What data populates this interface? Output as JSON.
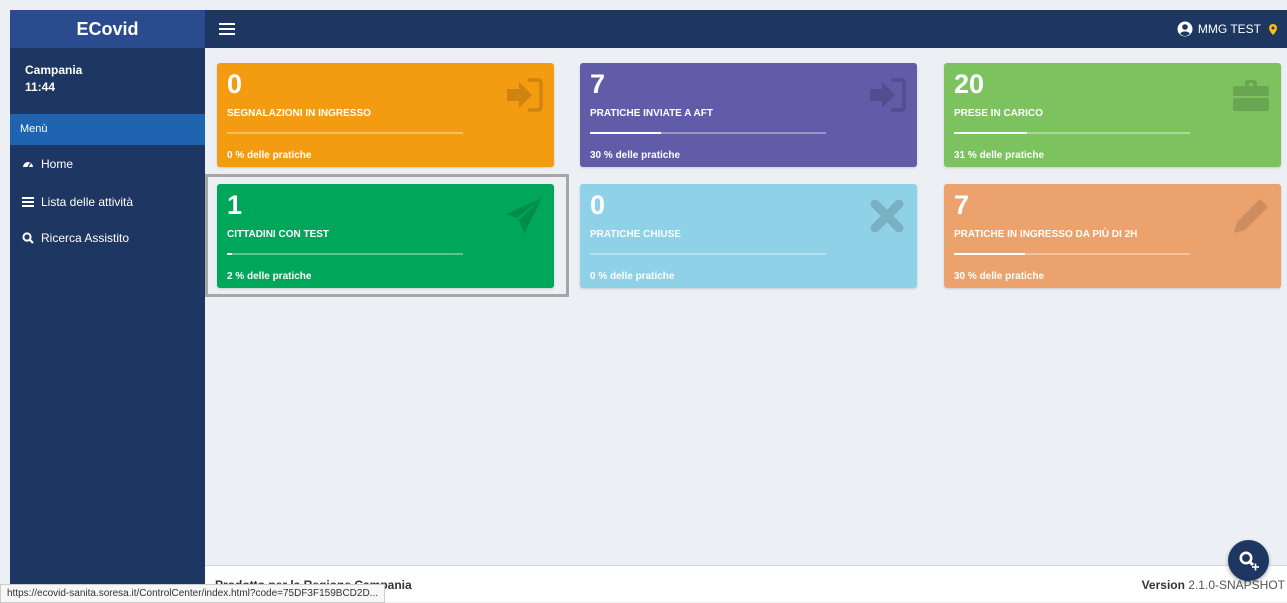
{
  "app": {
    "brand": "ECovid"
  },
  "header": {
    "user_name": "MMG TEST",
    "user_icon": "user-circle-icon",
    "location_icon": "map-pin-icon"
  },
  "sidebar": {
    "region": "Campania",
    "time": "11:44",
    "menu_header": "Menù",
    "items": [
      {
        "label": "Home",
        "icon": "dashboard-icon"
      },
      {
        "label": "Lista delle attività",
        "icon": "list-icon"
      },
      {
        "label": "Ricerca Assistito",
        "icon": "search-icon"
      }
    ]
  },
  "tiles": [
    {
      "count": "0",
      "label": "SEGNALAZIONI IN INGRESSO",
      "percent_text": "0 % delle pratiche",
      "progress": 0,
      "color": "#f39c12",
      "icon": "sign-in-icon"
    },
    {
      "count": "7",
      "label": "PRATICHE INVIATE A AFT",
      "percent_text": "30 % delle pratiche",
      "progress": 30,
      "color": "#605ca8",
      "icon": "sign-in-icon"
    },
    {
      "count": "20",
      "label": "PRESE IN CARICO",
      "percent_text": "31 % delle pratiche",
      "progress": 31,
      "color": "#7cc360",
      "icon": "briefcase-icon"
    },
    {
      "count": "1",
      "label": "CITTADINI CON TEST",
      "percent_text": "2 % delle pratiche",
      "progress": 2,
      "color": "#00a65a",
      "icon": "paper-plane-icon"
    },
    {
      "count": "0",
      "label": "PRATICHE CHIUSE",
      "percent_text": "0 % delle pratiche",
      "progress": 0,
      "color": "#8fd1e6",
      "icon": "close-icon"
    },
    {
      "count": "7",
      "label": "PRATICHE IN INGRESSO DA PIÙ DI 2H",
      "percent_text": "30 % delle pratiche",
      "progress": 30,
      "color": "#eca26c",
      "icon": "pencil-icon"
    }
  ],
  "footer": {
    "left_text": "Prodotto per la Regione Campania",
    "version_label": "Version",
    "version_value": "2.1.0-SNAPSHOT"
  },
  "status_url": "https://ecovid-sanita.soresa.it/ControlCenter/index.html?code=75DF3F159BCD2D...",
  "fab": {
    "icon": "search-plus-icon"
  }
}
